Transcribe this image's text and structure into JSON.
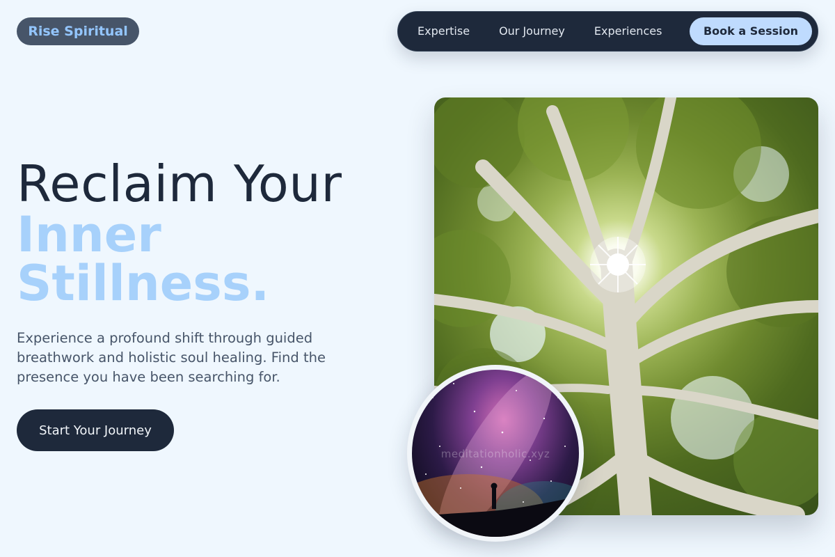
{
  "brand": {
    "logo": "Rise Spiritual"
  },
  "nav": {
    "links": [
      "Expertise",
      "Our Journey",
      "Experiences"
    ],
    "cta": "Book a Session"
  },
  "hero": {
    "title_line1": "Reclaim Your",
    "title_line2": "Inner",
    "title_line3": "Stillness.",
    "description": "Experience a profound shift through guided breathwork and holistic soul healing. Find the presence you have been searching for.",
    "cta": "Start Your Journey"
  },
  "images": {
    "main": "tree-canopy-sunburst-image",
    "inset": "starry-sky-silhouette-image",
    "inset_watermark": "meditationholic.xyz"
  },
  "colors": {
    "background": "#eff7fe",
    "dark": "#1e293b",
    "accent": "#a7d1fb",
    "nav_cta": "#bfdbfe",
    "logo_bg": "#475569"
  }
}
